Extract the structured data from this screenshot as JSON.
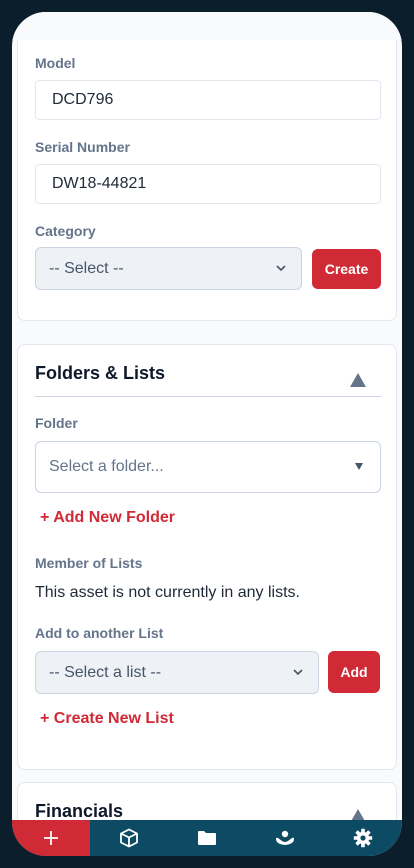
{
  "details": {
    "model_label": "Model",
    "model_value": "DCD796",
    "serial_label": "Serial Number",
    "serial_value": "DW18-44821",
    "category_label": "Category",
    "category_selected": "-- Select --",
    "category_create_button": "Create"
  },
  "folders_lists": {
    "title": "Folders & Lists",
    "folder_label": "Folder",
    "folder_placeholder": "Select a folder...",
    "add_folder_link": "+ Add New Folder",
    "member_label": "Member of Lists",
    "member_text": "This asset is not currently in any lists.",
    "add_list_label": "Add to another List",
    "list_selected": "-- Select a list --",
    "add_button": "Add",
    "create_list_link": "+ Create New List"
  },
  "financials": {
    "title": "Financials"
  },
  "bottom_nav": {
    "items": [
      "plus-icon",
      "box-icon",
      "folder-icon",
      "handshake-icon",
      "gear-icon"
    ],
    "active_index": 0,
    "accent": "#cf2a36",
    "background": "#0d4a63"
  }
}
